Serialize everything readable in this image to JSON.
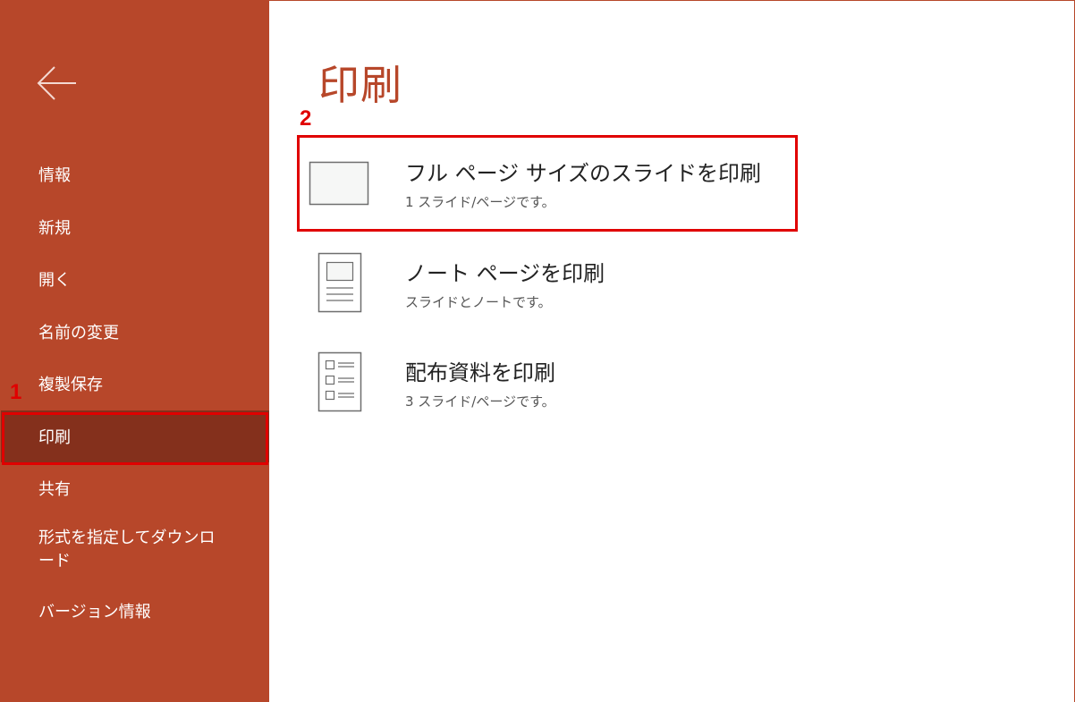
{
  "theme": {
    "accent": "#b7472a",
    "selected": "#84301c",
    "annotation": "#e00000"
  },
  "sidebar": {
    "back_icon": "arrow-left-icon",
    "items": [
      {
        "label": "情報"
      },
      {
        "label": "新規"
      },
      {
        "label": "開く"
      },
      {
        "label": "名前の変更"
      },
      {
        "label": "複製保存"
      },
      {
        "label": "印刷",
        "selected": true
      },
      {
        "label": "共有"
      },
      {
        "label": "形式を指定してダウンロード"
      },
      {
        "label": "バージョン情報"
      }
    ]
  },
  "annotations": {
    "step1": "1",
    "step2": "2"
  },
  "main": {
    "title": "印刷",
    "options": [
      {
        "title": "フル ページ サイズのスライドを印刷",
        "subtitle": "1 スライド/ページです。",
        "icon": "full-slide-icon"
      },
      {
        "title": "ノート ページを印刷",
        "subtitle": "スライドとノートです。",
        "icon": "notes-page-icon"
      },
      {
        "title": "配布資料を印刷",
        "subtitle": "3 スライド/ページです。",
        "icon": "handout-icon"
      }
    ]
  }
}
